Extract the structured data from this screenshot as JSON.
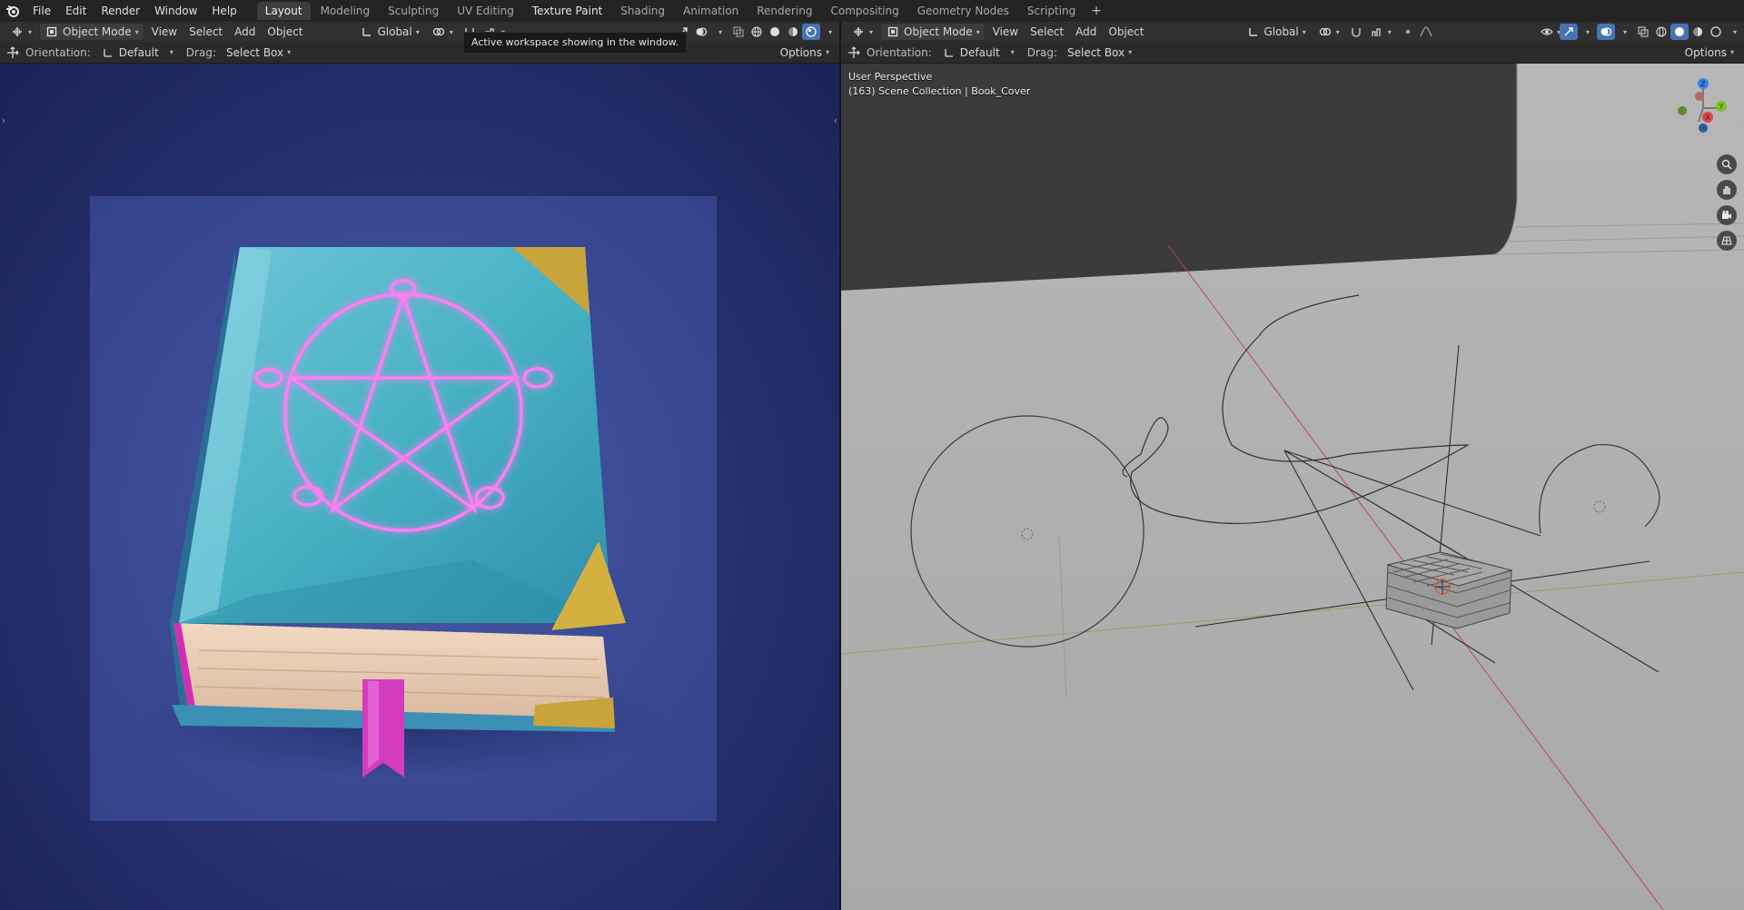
{
  "menu": {
    "items": [
      "File",
      "Edit",
      "Render",
      "Window",
      "Help"
    ]
  },
  "workspaces": {
    "tabs": [
      "Layout",
      "Modeling",
      "Sculpting",
      "UV Editing",
      "Texture Paint",
      "Shading",
      "Animation",
      "Rendering",
      "Compositing",
      "Geometry Nodes",
      "Scripting"
    ],
    "active": "Layout",
    "add_label": "+"
  },
  "tooltip": {
    "text": "Active workspace showing in the window."
  },
  "left": {
    "mode_label": "Object Mode",
    "view_label": "View",
    "select_label": "Select",
    "add_label": "Add",
    "object_label": "Object",
    "transform_label": "Global",
    "orientation_label": "Orientation:",
    "orientation_value": "Default",
    "drag_label": "Drag:",
    "drag_value": "Select Box",
    "options_label": "Options"
  },
  "right": {
    "mode_label": "Object Mode",
    "view_label": "View",
    "select_label": "Select",
    "add_label": "Add",
    "object_label": "Object",
    "transform_label": "Global",
    "orientation_label": "Orientation:",
    "orientation_value": "Default",
    "drag_label": "Drag:",
    "drag_value": "Select Box",
    "options_label": "Options",
    "view_name": "User Perspective",
    "collection_info": "(163) Scene Collection | Book_Cover"
  },
  "gizmo": {
    "x_label": "X",
    "y_label": "Y",
    "z_label": "Z",
    "x_color": "#e0424f",
    "y_color": "#7cc12a",
    "z_color": "#3b82e6"
  },
  "colors": {
    "accent": "#4772b3",
    "pentagram_glow": "#ff6ef0",
    "book_cover": "#3fb0c7",
    "bookmark": "#d43cc0",
    "corner_gold": "#c9a43a"
  }
}
